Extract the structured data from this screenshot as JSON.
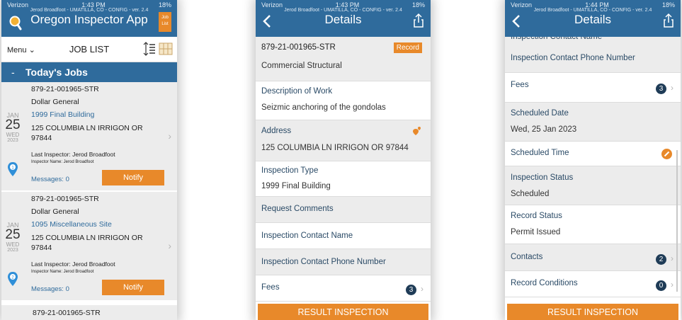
{
  "status": {
    "carrier": "Verizon",
    "time1": "1:43 PM",
    "time2": "1:43 PM",
    "time3": "1:44 PM",
    "battery": "18%",
    "subline": "Jerod Broadfoot - UMATILLA, CO - CONFIG - ver. 2.4"
  },
  "screen1": {
    "title": "Oregon Inspector App",
    "joblist_button": "Job List",
    "menu_label": "Menu ⌄",
    "page_title": "JOB LIST",
    "section_dash": "-",
    "section_title": "Today's Jobs",
    "jobs": [
      {
        "record": "879-21-001965-STR",
        "customer": "Dollar General",
        "inspection": "1999 Final Building",
        "address": "125 COLUMBIA LN IRRIGON OR 97844",
        "month": "JAN",
        "day": "25",
        "weekday": "WED",
        "year": "2023",
        "pin_number": "1",
        "last_inspector": "Last Inspector:   Jerod Broadfoot",
        "inspector_name": "Inspector Name: Jerod Broadfoot",
        "messages": "Messages: 0",
        "notify": "Notify"
      },
      {
        "record": "879-21-001965-STR",
        "customer": "Dollar General",
        "inspection": "1095 Miscellaneous Site",
        "address": "125 COLUMBIA LN IRRIGON OR 97844",
        "month": "JAN",
        "day": "25",
        "weekday": "WED",
        "year": "2023",
        "pin_number": "2",
        "last_inspector": "Last Inspector:   Jerod Broadfoot",
        "inspector_name": "Inspector Name: Jerod Broadfoot",
        "messages": "Messages: 0",
        "notify": "Notify"
      }
    ],
    "next_record": "879-21-001965-STR"
  },
  "screen2": {
    "title": "Details",
    "record_no": "879-21-001965-STR",
    "record_button": "Record",
    "record_type": "Commercial Structural",
    "desc_label": "Description of Work",
    "desc_value": "Seizmic anchoring of the gondolas",
    "address_label": "Address",
    "address_value": "125 COLUMBIA LN IRRIGON OR 97844",
    "type_label": "Inspection Type",
    "type_value": "1999 Final Building",
    "comments_label": "Request Comments",
    "contact_name_label": "Inspection Contact Name",
    "contact_phone_label": "Inspection Contact Phone Number",
    "fees_label": "Fees",
    "fees_count": "3",
    "result_button": "RESULT INSPECTION"
  },
  "screen3": {
    "title": "Details",
    "partial_label": "Inspection Contact Name",
    "contact_phone_label": "Inspection Contact Phone Number",
    "fees_label": "Fees",
    "fees_count": "3",
    "sched_date_label": "Scheduled Date",
    "sched_date_value": "Wed, 25 Jan 2023",
    "sched_time_label": "Scheduled Time",
    "insp_status_label": "Inspection Status",
    "insp_status_value": "Scheduled",
    "record_status_label": "Record Status",
    "record_status_value": "Permit Issued",
    "contacts_label": "Contacts",
    "contacts_count": "2",
    "conditions_label": "Record Conditions",
    "conditions_count": "0",
    "result_button": "RESULT INSPECTION"
  },
  "colors": {
    "brand_blue": "#2f6b9c",
    "accent_orange": "#e8892a",
    "badge_navy": "#1f3c57"
  },
  "icons": [
    "magnifier-logo-icon",
    "sort-icon",
    "map-icon",
    "location-pin-icon",
    "back-chevron-icon",
    "share-icon",
    "address-pin-icon",
    "edit-pencil-icon"
  ]
}
